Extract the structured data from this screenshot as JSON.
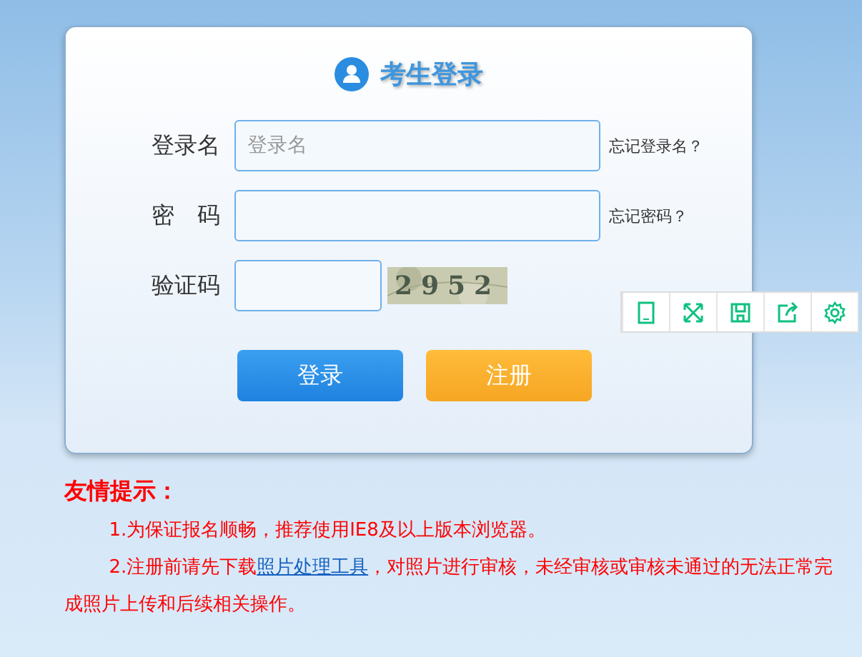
{
  "login_panel": {
    "title": "考生登录",
    "fields": [
      {
        "label": "登录名",
        "placeholder": "登录名",
        "kind": "text",
        "help_link": "忘记登录名？"
      },
      {
        "label": "密　码",
        "kind": "password",
        "help_link": "忘记密码？"
      },
      {
        "label": "验证码",
        "kind": "captcha",
        "captcha_code": "2952"
      }
    ],
    "buttons": [
      {
        "label": "登录",
        "kind": "primary"
      },
      {
        "label": "注册",
        "kind": "secondary"
      }
    ]
  },
  "tips": {
    "title": "友情提示：",
    "items": [
      {
        "text": "1.为保证报名顺畅，推荐使用IE8及以上版本浏览器。"
      },
      {
        "text": "2.注册前请先下载",
        "link": "照片处理工具",
        "after": "，对照片进行审核，未经审核或审核未通过的无法正常完成照片上传和后续相关操作。"
      }
    ]
  },
  "side_toolbar": {
    "tools": [
      {
        "kind": "tablet"
      },
      {
        "kind": "fullscreen"
      },
      {
        "kind": "save"
      },
      {
        "kind": "share"
      },
      {
        "kind": "settings"
      }
    ]
  }
}
